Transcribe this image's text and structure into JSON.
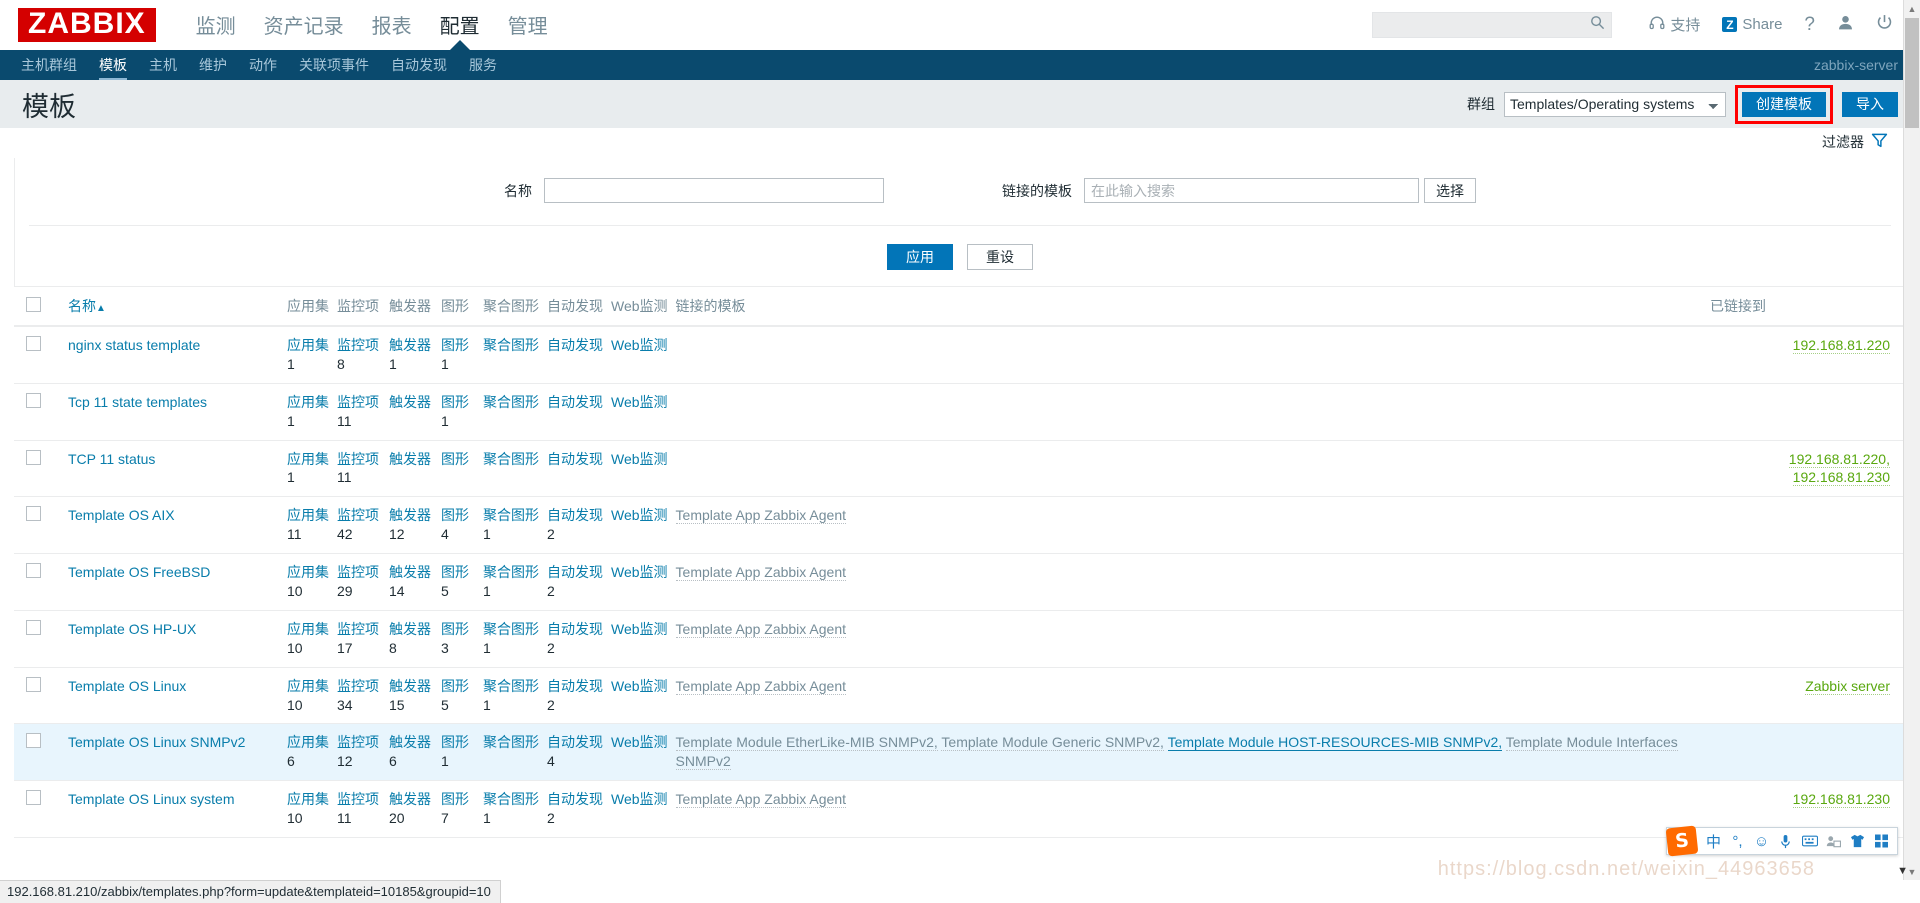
{
  "header": {
    "logo": "ZABBIX",
    "menu": [
      {
        "label": "监测",
        "active": false
      },
      {
        "label": "资产记录",
        "active": false
      },
      {
        "label": "报表",
        "active": false
      },
      {
        "label": "配置",
        "active": true
      },
      {
        "label": "管理",
        "active": false
      }
    ],
    "search_placeholder": "",
    "search_value": "",
    "support_label": "支持",
    "share_label": "Share",
    "share_badge": "Z",
    "help_label": "?"
  },
  "subnav": {
    "items": [
      {
        "label": "主机群组",
        "active": false
      },
      {
        "label": "模板",
        "active": true
      },
      {
        "label": "主机",
        "active": false
      },
      {
        "label": "维护",
        "active": false
      },
      {
        "label": "动作",
        "active": false
      },
      {
        "label": "关联项事件",
        "active": false
      },
      {
        "label": "自动发现",
        "active": false
      },
      {
        "label": "服务",
        "active": false
      }
    ],
    "server_name": "zabbix-server"
  },
  "page": {
    "title": "模板",
    "group_label": "群组",
    "group_selected": "Templates/Operating systems",
    "create_button": "创建模板",
    "import_button": "导入",
    "highlight_color": "#ff0000"
  },
  "filter": {
    "tab_label": "过滤器",
    "name_label": "名称",
    "name_value": "",
    "name_placeholder": "",
    "linked_label": "链接的模板",
    "linked_value": "",
    "linked_placeholder": "在此输入搜索",
    "select_button": "选择",
    "apply_button": "应用",
    "reset_button": "重设"
  },
  "table": {
    "headers": {
      "name": "名称",
      "sort_arrow": "▲",
      "applications": "应用集",
      "items": "监控项",
      "triggers": "触发器",
      "graphs": "图形",
      "screens": "聚合图形",
      "discovery": "自动发现",
      "web": "Web监测",
      "linked_templates": "链接的模板",
      "linked_to": "已链接到"
    },
    "rows": [
      {
        "name": "nginx status template",
        "applications": "应用集",
        "applications_count": "1",
        "items": "监控项",
        "items_count": "8",
        "triggers": "触发器",
        "triggers_count": "1",
        "graphs": "图形",
        "graphs_count": "1",
        "screens": "聚合图形",
        "screens_count": "",
        "discovery": "自动发现",
        "discovery_count": "",
        "web": "Web监测",
        "linked_templates": [],
        "linked_to": [
          "192.168.81.220"
        ],
        "hover": false
      },
      {
        "name": "Tcp 11 state templates",
        "applications": "应用集",
        "applications_count": "1",
        "items": "监控项",
        "items_count": "11",
        "triggers": "触发器",
        "triggers_count": "",
        "graphs": "图形",
        "graphs_count": "1",
        "screens": "聚合图形",
        "screens_count": "",
        "discovery": "自动发现",
        "discovery_count": "",
        "web": "Web监测",
        "linked_templates": [],
        "linked_to": [],
        "hover": false
      },
      {
        "name": "TCP 11 status",
        "applications": "应用集",
        "applications_count": "1",
        "items": "监控项",
        "items_count": "11",
        "triggers": "触发器",
        "triggers_count": "",
        "graphs": "图形",
        "graphs_count": "",
        "screens": "聚合图形",
        "screens_count": "",
        "discovery": "自动发现",
        "discovery_count": "",
        "web": "Web监测",
        "linked_templates": [],
        "linked_to": [
          "192.168.81.220,",
          "192.168.81.230"
        ],
        "hover": false
      },
      {
        "name": "Template OS AIX",
        "applications": "应用集",
        "applications_count": "11",
        "items": "监控项",
        "items_count": "42",
        "triggers": "触发器",
        "triggers_count": "12",
        "graphs": "图形",
        "graphs_count": "4",
        "screens": "聚合图形",
        "screens_count": "1",
        "discovery": "自动发现",
        "discovery_count": "2",
        "web": "Web监测",
        "linked_templates": [
          "Template App Zabbix Agent"
        ],
        "linked_to": [],
        "hover": false
      },
      {
        "name": "Template OS FreeBSD",
        "applications": "应用集",
        "applications_count": "10",
        "items": "监控项",
        "items_count": "29",
        "triggers": "触发器",
        "triggers_count": "14",
        "graphs": "图形",
        "graphs_count": "5",
        "screens": "聚合图形",
        "screens_count": "1",
        "discovery": "自动发现",
        "discovery_count": "2",
        "web": "Web监测",
        "linked_templates": [
          "Template App Zabbix Agent"
        ],
        "linked_to": [],
        "hover": false
      },
      {
        "name": "Template OS HP-UX",
        "applications": "应用集",
        "applications_count": "10",
        "items": "监控项",
        "items_count": "17",
        "triggers": "触发器",
        "triggers_count": "8",
        "graphs": "图形",
        "graphs_count": "3",
        "screens": "聚合图形",
        "screens_count": "1",
        "discovery": "自动发现",
        "discovery_count": "2",
        "web": "Web监测",
        "linked_templates": [
          "Template App Zabbix Agent"
        ],
        "linked_to": [],
        "hover": false
      },
      {
        "name": "Template OS Linux",
        "applications": "应用集",
        "applications_count": "10",
        "items": "监控项",
        "items_count": "34",
        "triggers": "触发器",
        "triggers_count": "15",
        "graphs": "图形",
        "graphs_count": "5",
        "screens": "聚合图形",
        "screens_count": "1",
        "discovery": "自动发现",
        "discovery_count": "2",
        "web": "Web监测",
        "linked_templates": [
          "Template App Zabbix Agent"
        ],
        "linked_to": [
          "Zabbix server"
        ],
        "hover": false
      },
      {
        "name": "Template OS Linux SNMPv2",
        "applications": "应用集",
        "applications_count": "6",
        "items": "监控项",
        "items_count": "12",
        "triggers": "触发器",
        "triggers_count": "6",
        "graphs": "图形",
        "graphs_count": "1",
        "screens": "聚合图形",
        "screens_count": "",
        "discovery": "自动发现",
        "discovery_count": "4",
        "web": "Web监测",
        "linked_templates": [
          "Template Module EtherLike-MIB SNMPv2,",
          "Template Module Generic SNMPv2,",
          "Template Module HOST-RESOURCES-MIB SNMPv2,",
          "Template Module Interfaces SNMPv2"
        ],
        "linked_templates_highlight_index": 2,
        "linked_to": [],
        "hover": true
      },
      {
        "name": "Template OS Linux system",
        "applications": "应用集",
        "applications_count": "10",
        "items": "监控项",
        "items_count": "11",
        "triggers": "触发器",
        "triggers_count": "20",
        "graphs": "图形",
        "graphs_count": "7",
        "screens": "聚合图形",
        "screens_count": "1",
        "discovery": "自动发现",
        "discovery_count": "2",
        "web": "Web监测",
        "linked_templates": [
          "Template App Zabbix Agent"
        ],
        "linked_to": [
          "192.168.81.230"
        ],
        "hover": false
      }
    ]
  },
  "statusbar": {
    "url": "192.168.81.210/zabbix/templates.php?form=update&templateid=10185&groupid=10"
  },
  "ime": {
    "logo": "S",
    "mode": "中",
    "punct": "°,",
    "icons": [
      "smiley-icon",
      "microphone-icon",
      "keyboard-icon",
      "user-card-icon",
      "skin-icon",
      "toolbox-icon"
    ]
  },
  "watermark": "https://blog.csdn.net/weixin_44963658"
}
